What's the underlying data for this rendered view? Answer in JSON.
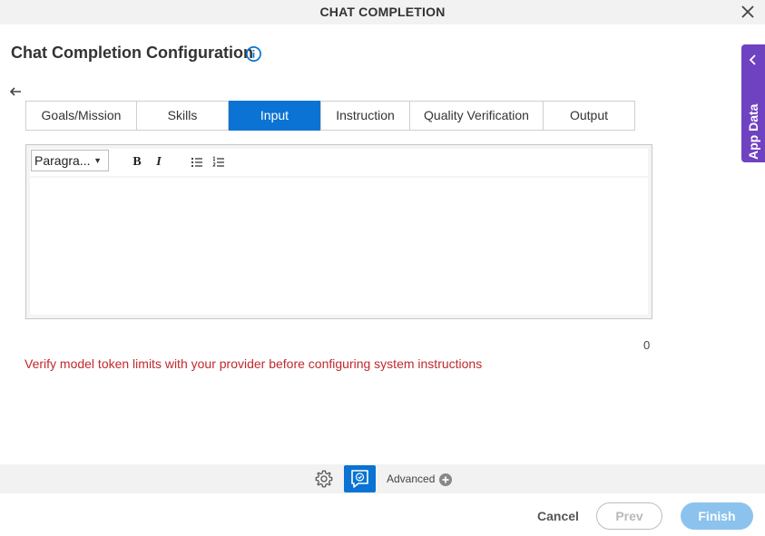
{
  "window": {
    "title": "CHAT COMPLETION"
  },
  "header": {
    "title": "Chat Completion Configuration"
  },
  "tabs": [
    {
      "label": "Goals/Mission",
      "active": false
    },
    {
      "label": "Skills",
      "active": false
    },
    {
      "label": "Input",
      "active": true
    },
    {
      "label": "Instruction",
      "active": false
    },
    {
      "label": "Quality Verification",
      "active": false
    },
    {
      "label": "Output",
      "active": false
    }
  ],
  "editor": {
    "paragraph_select": "Paragra...",
    "bold_label": "B",
    "italic_label": "I",
    "content": ""
  },
  "char_count": "0",
  "warning": "Verify model token limits with your provider before configuring system instructions",
  "footer": {
    "advanced_label": "Advanced",
    "cancel_label": "Cancel",
    "prev_label": "Prev",
    "finish_label": "Finish"
  },
  "side_panel": {
    "label": "App Data"
  },
  "colors": {
    "accent": "#0a73d4",
    "side_panel": "#6f42c1",
    "warning": "#c0292c",
    "finish_disabled": "#8cc3ee"
  }
}
